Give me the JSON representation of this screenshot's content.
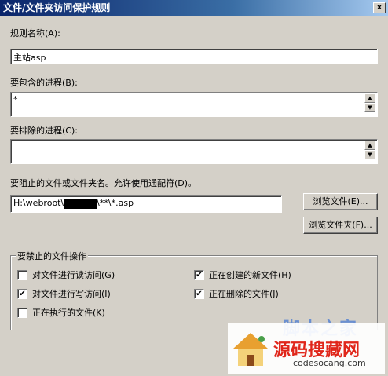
{
  "window": {
    "title": "文件/文件夹访问保护规则",
    "close_glyph": "x"
  },
  "rule_name": {
    "label": "规则名称(A):",
    "value": "主站asp"
  },
  "include_processes": {
    "label": "要包含的进程(B):",
    "value": "*"
  },
  "exclude_processes": {
    "label": "要排除的进程(C):",
    "value": ""
  },
  "block_files": {
    "label": "要阻止的文件或文件夹名。允许使用通配符(D)。",
    "value_prefix": "H:\\webroot\\",
    "value_suffix": "\\**\\*.asp"
  },
  "buttons": {
    "browse_file": "浏览文件(E)...",
    "browse_folder": "浏览文件夹(F)..."
  },
  "forbidden_ops": {
    "title": "要禁止的文件操作",
    "read": {
      "label": "对文件进行读访问(G)",
      "checked": false
    },
    "write": {
      "label": "对文件进行写访问(I)",
      "checked": true
    },
    "execute": {
      "label": "正在执行的文件(K)",
      "checked": false
    },
    "create": {
      "label": "正在创建的新文件(H)",
      "checked": true
    },
    "delete": {
      "label": "正在删除的文件(J)",
      "checked": true
    }
  },
  "watermark": {
    "site_top": "脚本之家",
    "site_name": "源码搜藏网",
    "url": "codesocang.com"
  },
  "colors": {
    "dialog_bg": "#d4d0c8",
    "title_start": "#0a246a",
    "watermark_red": "#e0261a"
  }
}
